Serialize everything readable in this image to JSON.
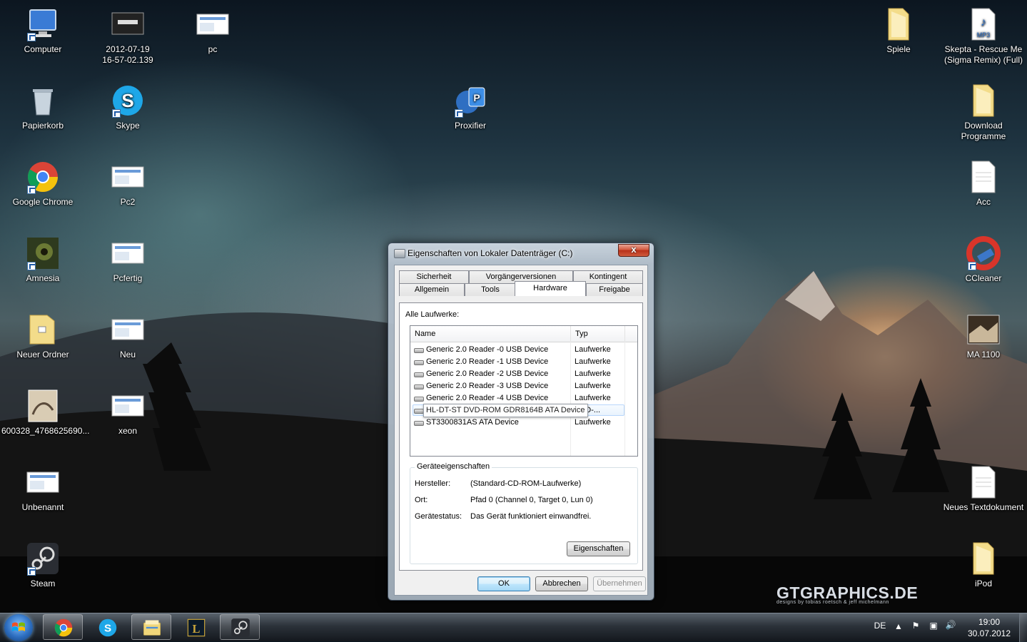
{
  "desktop": {
    "icons_left": [
      {
        "label": "Computer"
      },
      {
        "label": "2012-07-19\n16-57-02.139"
      },
      {
        "label": "pc"
      },
      {
        "label": "Papierkorb"
      },
      {
        "label": "Skype"
      },
      {
        "label": "Proxifier"
      },
      {
        "label": "Google Chrome"
      },
      {
        "label": "Pc2"
      },
      {
        "label": "Amnesia"
      },
      {
        "label": "Pcfertig"
      },
      {
        "label": "Neuer Ordner"
      },
      {
        "label": "Neu"
      },
      {
        "label": "600328_4768625690..."
      },
      {
        "label": "xeon"
      },
      {
        "label": "Unbenannt"
      },
      {
        "label": "Steam"
      }
    ],
    "icons_right": [
      {
        "label": "Spiele"
      },
      {
        "label": "Skepta - Rescue Me\n(Sigma Remix) (Full)"
      },
      {
        "label": "Download\nProgramme"
      },
      {
        "label": "Acc"
      },
      {
        "label": "CCleaner"
      },
      {
        "label": "MA 1100"
      },
      {
        "label": "Neues Textdokument"
      },
      {
        "label": "iPod"
      }
    ],
    "watermark": {
      "big": "GTGRAPHICS.DE",
      "small": "designs by tobias roetsch & jeff michelmann"
    }
  },
  "dialog": {
    "title": "Eigenschaften von Lokaler Datenträger (C:)",
    "close_label": "x",
    "tabs_back": [
      "Sicherheit",
      "Vorgängerversionen",
      "Kontingent"
    ],
    "tabs_front": [
      "Allgemein",
      "Tools",
      "Hardware",
      "Freigabe"
    ],
    "active_tab": "Hardware",
    "all_drives_label": "Alle Laufwerke:",
    "columns": [
      "Name",
      "Typ"
    ],
    "rows": [
      {
        "name": "Generic 2.0 Reader   -0 USB Device",
        "type": "Laufwerke"
      },
      {
        "name": "Generic 2.0 Reader   -1 USB Device",
        "type": "Laufwerke"
      },
      {
        "name": "Generic 2.0 Reader   -2 USB Device",
        "type": "Laufwerke"
      },
      {
        "name": "Generic 2.0 Reader   -3 USB Device",
        "type": "Laufwerke"
      },
      {
        "name": "Generic 2.0 Reader   -4 USB Device",
        "type": "Laufwerke"
      },
      {
        "name": "HL-DT-ST DVD-ROM GDR8164B ATA Device",
        "type": "VCD-..."
      },
      {
        "name": "ST3300831AS ATA Device",
        "type": "Laufwerke"
      }
    ],
    "device_props": {
      "title": "Geräteeigenschaften",
      "manufacturer_label": "Hersteller:",
      "manufacturer": "(Standard-CD-ROM-Laufwerke)",
      "location_label": "Ort:",
      "location": "Pfad 0 (Channel 0, Target 0, Lun 0)",
      "status_label": "Gerätestatus:",
      "status": "Das Gerät funktioniert einwandfrei.",
      "properties_button": "Eigenschaften"
    },
    "buttons": {
      "ok": "OK",
      "cancel": "Abbrechen",
      "apply": "Übernehmen"
    }
  },
  "taskbar": {
    "language": "DE",
    "time": "19:00",
    "date": "30.07.2012",
    "apps": [
      "chrome-icon",
      "skype-icon",
      "explorer-icon",
      "league-icon",
      "steam-icon"
    ]
  }
}
